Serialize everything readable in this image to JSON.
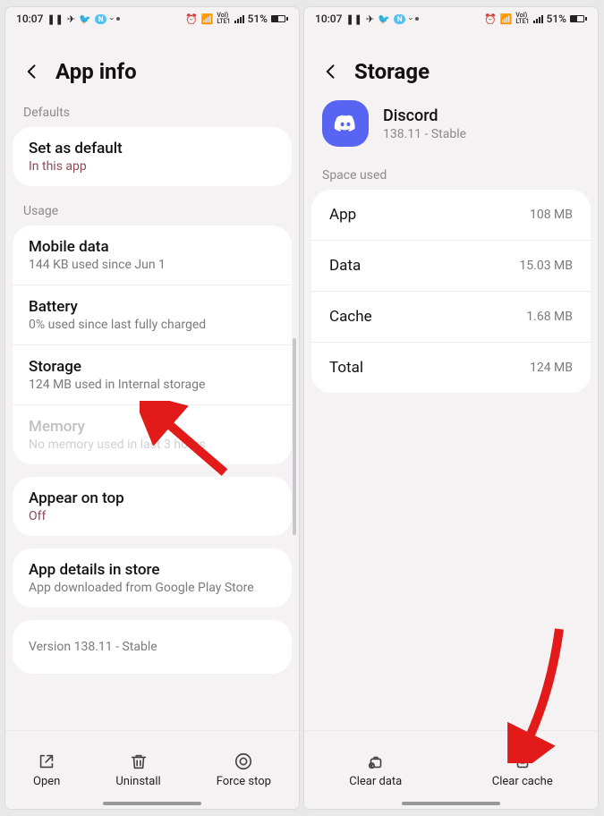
{
  "statusbar": {
    "time": "10:07",
    "battery": "51%"
  },
  "left": {
    "title": "App info",
    "defaults_label": "Defaults",
    "defaults": {
      "title": "Set as default",
      "sub": "In this app"
    },
    "usage_label": "Usage",
    "mobile_data": {
      "title": "Mobile data",
      "sub": "144 KB used since Jun 1"
    },
    "battery": {
      "title": "Battery",
      "sub": "0% used since last fully charged"
    },
    "storage": {
      "title": "Storage",
      "sub": "124 MB used in Internal storage"
    },
    "memory": {
      "title": "Memory",
      "sub": "No memory used in last 3 hours"
    },
    "appear": {
      "title": "Appear on top",
      "sub": "Off"
    },
    "details": {
      "title": "App details in store",
      "sub": "App downloaded from Google Play Store"
    },
    "version": "Version 138.11 - Stable",
    "bottom": {
      "open": "Open",
      "uninstall": "Uninstall",
      "forcestop": "Force stop"
    }
  },
  "right": {
    "title": "Storage",
    "app": {
      "name": "Discord",
      "version": "138.11 - Stable"
    },
    "space_label": "Space used",
    "rows": {
      "app": {
        "k": "App",
        "v": "108 MB"
      },
      "data": {
        "k": "Data",
        "v": "15.03 MB"
      },
      "cache": {
        "k": "Cache",
        "v": "1.68 MB"
      },
      "total": {
        "k": "Total",
        "v": "124 MB"
      }
    },
    "bottom": {
      "cleardata": "Clear data",
      "clearcache": "Clear cache"
    }
  }
}
